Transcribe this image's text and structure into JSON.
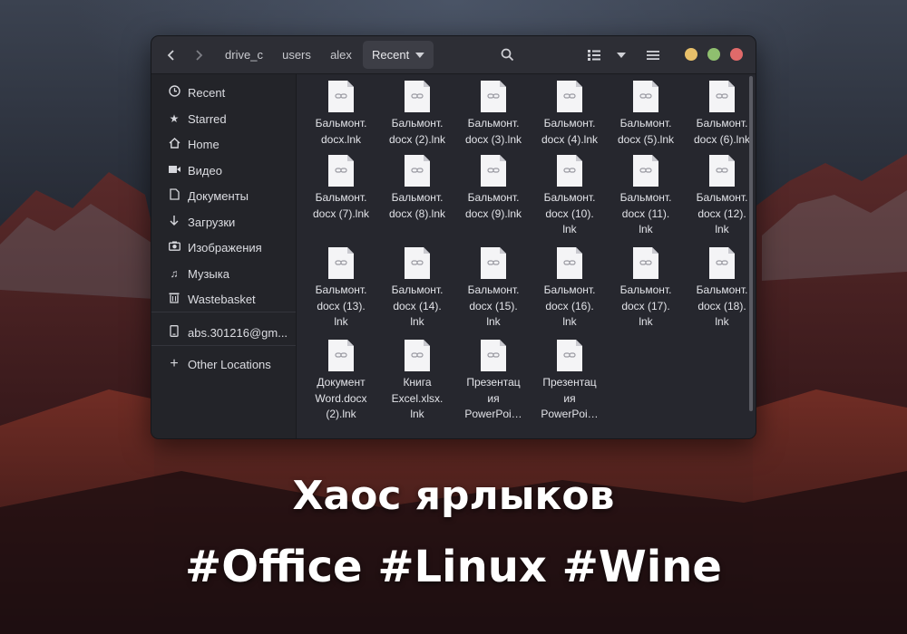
{
  "window": {
    "nav": {
      "back_icon": "chevron-left-icon",
      "forward_icon": "chevron-right-icon"
    },
    "breadcrumb": [
      "drive_c",
      "users",
      "alex"
    ],
    "current_location": "Recent",
    "colors": {
      "minimize": "#e8c06a",
      "maximize": "#8fbf6f",
      "close": "#e06a6a"
    }
  },
  "sidebar": {
    "items": [
      {
        "label": "Recent",
        "icon": "clock-icon"
      },
      {
        "label": "Starred",
        "icon": "star-icon"
      },
      {
        "label": "Home",
        "icon": "home-icon"
      },
      {
        "label": "Видео",
        "icon": "video-icon"
      },
      {
        "label": "Документы",
        "icon": "document-icon"
      },
      {
        "label": "Загрузки",
        "icon": "download-icon"
      },
      {
        "label": "Изображения",
        "icon": "camera-icon"
      },
      {
        "label": "Музыка",
        "icon": "music-icon"
      },
      {
        "label": "Wastebasket",
        "icon": "trash-icon"
      }
    ],
    "account": {
      "label": "abs.301216@gm...",
      "icon": "phone-icon"
    },
    "other_locations": {
      "label": "Other Locations",
      "icon": "plus-icon"
    }
  },
  "files": [
    "Бальмонт.\ndocx.lnk",
    "Бальмонт.\ndocx (2).lnk",
    "Бальмонт.\ndocx (3).lnk",
    "Бальмонт.\ndocx (4).lnk",
    "Бальмонт.\ndocx (5).lnk",
    "Бальмонт.\ndocx (6).lnk",
    "Бальмонт.\ndocx (7).lnk",
    "Бальмонт.\ndocx (8).lnk",
    "Бальмонт.\ndocx (9).lnk",
    "Бальмонт.\ndocx (10).\nlnk",
    "Бальмонт.\ndocx (11).\nlnk",
    "Бальмонт.\ndocx (12).\nlnk",
    "Бальмонт.\ndocx (13).\nlnk",
    "Бальмонт.\ndocx (14).\nlnk",
    "Бальмонт.\ndocx (15).\nlnk",
    "Бальмонт.\ndocx (16).\nlnk",
    "Бальмонт.\ndocx (17).\nlnk",
    "Бальмонт.\ndocx (18).\nlnk",
    "Документ\nWord.docx\n(2).lnk",
    "Книга\nExcel.xlsx.\nlnk",
    "Презентац\nия\nPowerPoi…",
    "Презентац\nия\nPowerPoi…"
  ],
  "caption": {
    "line1": "Хаос ярлыков",
    "line2": "#Office #Linux #Wine"
  }
}
